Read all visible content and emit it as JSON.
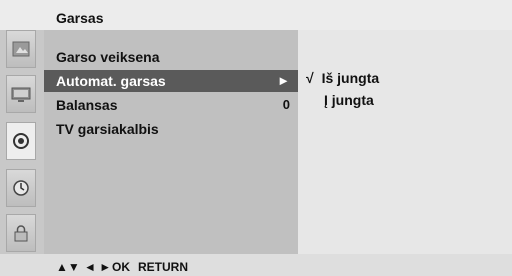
{
  "header": {
    "title": "Garsas"
  },
  "menu": {
    "items": [
      {
        "label": "Garso veiksena",
        "value": ""
      },
      {
        "label": "Automat. garsas",
        "value": "►"
      },
      {
        "label": "Balansas",
        "value": "0"
      },
      {
        "label": "TV garsiakalbis",
        "value": ""
      }
    ]
  },
  "submenu": {
    "options": [
      {
        "check": "√",
        "label": "Iš jungta"
      },
      {
        "label": "Į jungta"
      }
    ]
  },
  "footer": {
    "updown": "▲▼",
    "leftright": "◄ ►",
    "ok": "OK",
    "return": "RETURN"
  },
  "colors": {
    "selected_bg": "#5a5a5a",
    "menu_bg": "#c0c0c0",
    "submenu_bg": "#e7e7e7",
    "rail_bg": "#c8c8c8"
  },
  "icons": [
    "picture-icon",
    "tv-screen-icon",
    "speaker-icon",
    "clock-icon",
    "lock-icon"
  ]
}
